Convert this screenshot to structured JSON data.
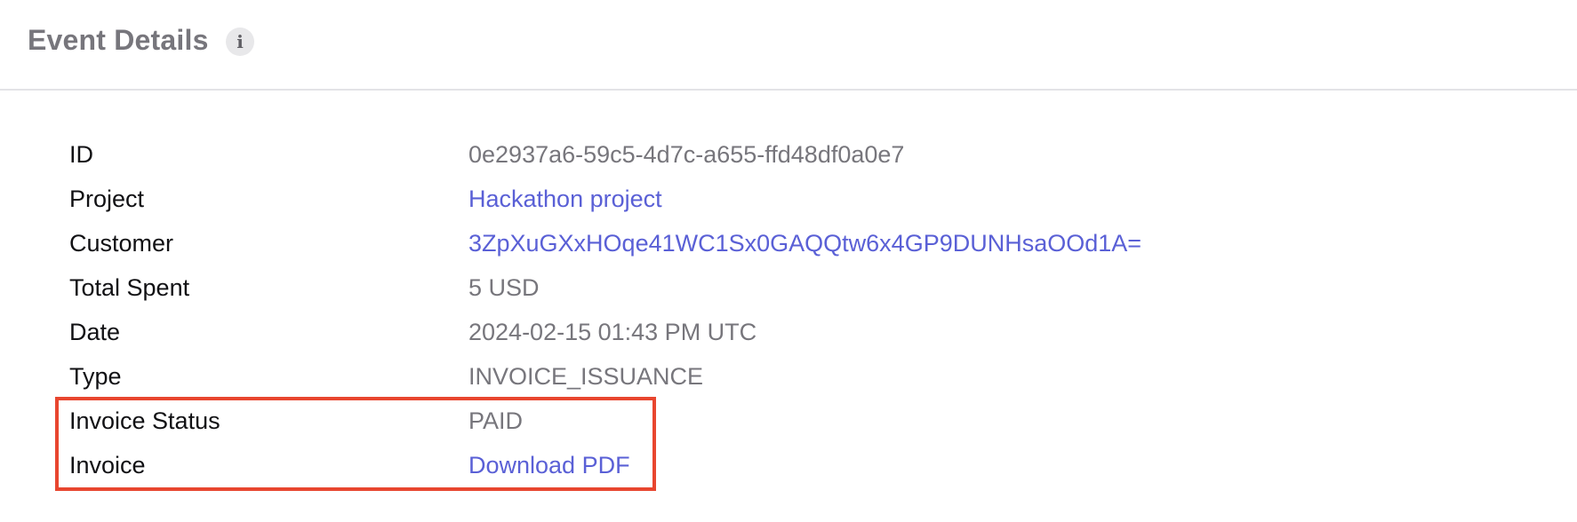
{
  "header": {
    "title": "Event Details",
    "info_icon_glyph": "i"
  },
  "details": {
    "rows": [
      {
        "label": "ID",
        "value": "0e2937a6-59c5-4d7c-a655-ffd48df0a0e7",
        "is_link": false
      },
      {
        "label": "Project",
        "value": "Hackathon project",
        "is_link": true
      },
      {
        "label": "Customer",
        "value": "3ZpXuGXxHOqe41WC1Sx0GAQQtw6x4GP9DUNHsaOOd1A=",
        "is_link": true
      },
      {
        "label": "Total Spent",
        "value": "5 USD",
        "is_link": false
      },
      {
        "label": "Date",
        "value": "2024-02-15 01:43 PM UTC",
        "is_link": false
      },
      {
        "label": "Type",
        "value": "INVOICE_ISSUANCE",
        "is_link": false
      },
      {
        "label": "Invoice Status",
        "value": "PAID",
        "is_link": false
      },
      {
        "label": "Invoice",
        "value": "Download PDF",
        "is_link": true
      }
    ]
  },
  "colors": {
    "link": "#5a60d6",
    "value_text": "#77767c",
    "label_text": "#111114",
    "highlight": "#e8462f"
  },
  "icons": {
    "info": "info-icon"
  }
}
